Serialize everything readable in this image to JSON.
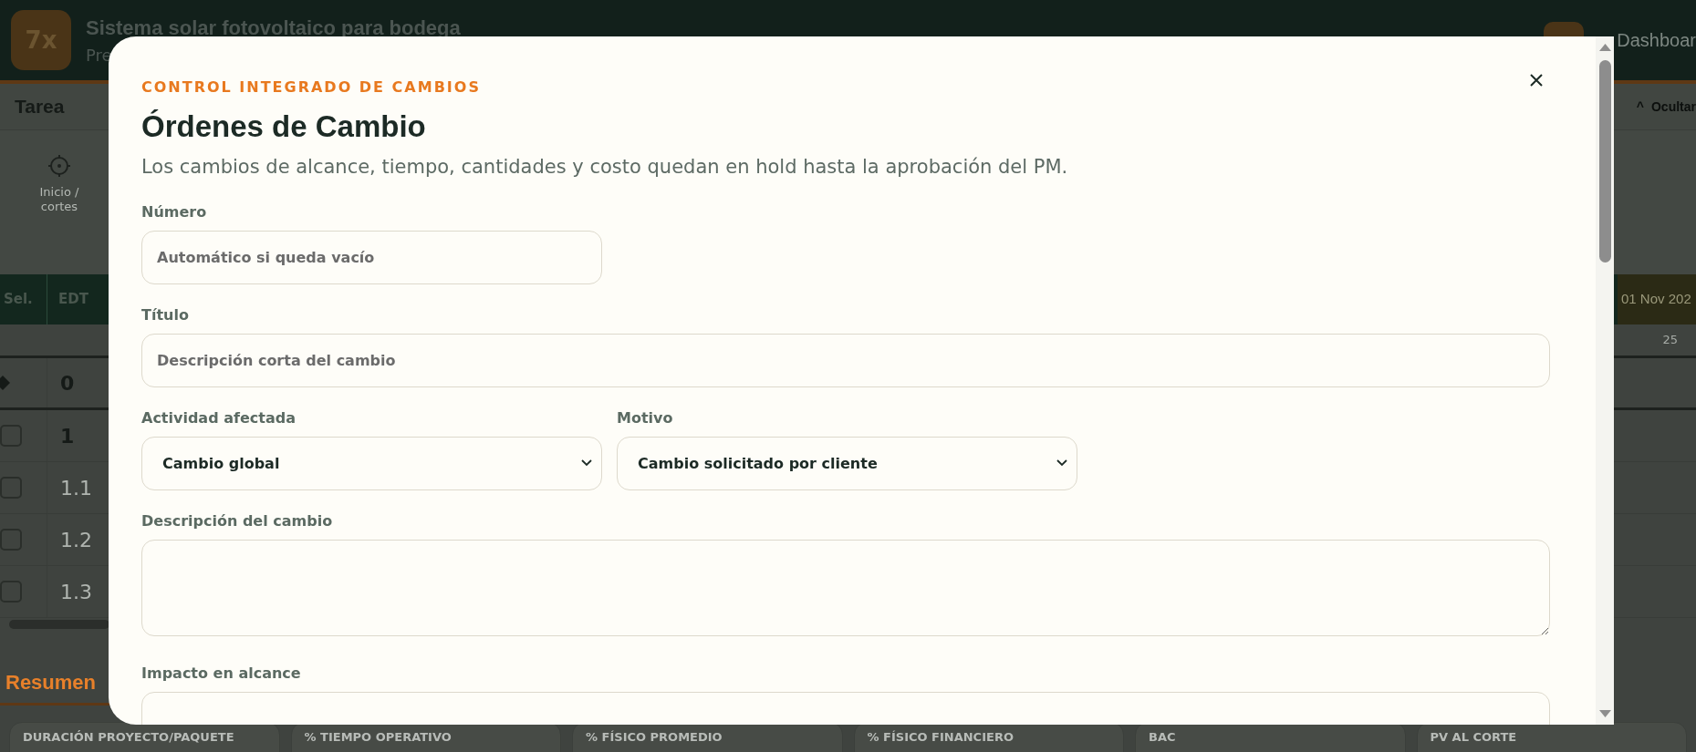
{
  "app_header": {
    "logo": "7x",
    "title": "Sistema solar fotovoltaico para bodega",
    "subtitle": "Pre",
    "nav_link": "Dashboar"
  },
  "task_bar": {
    "title": "Tarea",
    "toggle_icon": "^",
    "toggle_label": "Ocultar"
  },
  "tools": [
    {
      "label": "Inicio / cortes"
    }
  ],
  "table": {
    "columns": [
      "Sel.",
      "EDT"
    ],
    "timeline_header": "01 Nov 202",
    "day": "25",
    "rows": [
      {
        "kind": "milestone",
        "edt": "0"
      },
      {
        "kind": "summary",
        "edt": "1",
        "checked": false
      },
      {
        "kind": "task",
        "edt": "1.1",
        "checked": false
      },
      {
        "kind": "task",
        "edt": "1.2",
        "checked": false
      },
      {
        "kind": "task",
        "edt": "1.3",
        "checked": false
      }
    ]
  },
  "summary": {
    "title": "Resumen",
    "cards": [
      "DURACIÓN PROYECTO/PAQUETE",
      "% TIEMPO OPERATIVO",
      "% FÍSICO PROMEDIO",
      "% FÍSICO FINANCIERO",
      "BAC",
      "PV AL CORTE"
    ]
  },
  "modal": {
    "kicker": "CONTROL INTEGRADO DE CAMBIOS",
    "title": "Órdenes de Cambio",
    "subtitle": "Los cambios de alcance, tiempo, cantidades y costo quedan en hold hasta la aprobación del PM.",
    "rows": [
      [
        {
          "kind": "short_input",
          "label": "Número",
          "placeholder": "Automático si queda vacío"
        }
      ],
      [
        {
          "kind": "input",
          "label": "Título",
          "placeholder": "Descripción corta del cambio"
        }
      ],
      [
        {
          "kind": "select",
          "label": "Actividad afectada",
          "value": "Cambio global"
        },
        {
          "kind": "select",
          "label": "Motivo",
          "value": "Cambio solicitado por cliente"
        }
      ],
      [
        {
          "kind": "textarea",
          "label": "Descripción del cambio"
        }
      ],
      [
        {
          "kind": "textarea",
          "label": "Impacto en alcance"
        }
      ]
    ]
  }
}
